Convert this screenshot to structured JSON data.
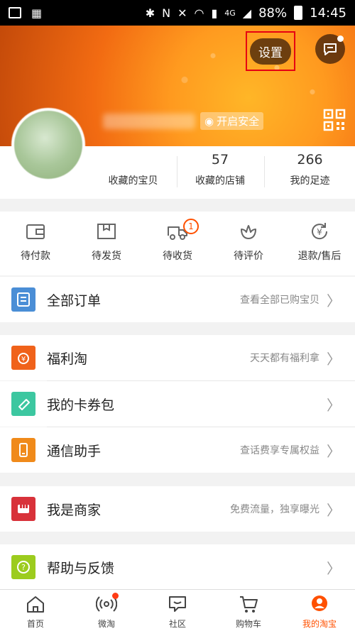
{
  "status_bar": {
    "battery": "88%",
    "time": "14:45",
    "network": "4G"
  },
  "header": {
    "settings_label": "设置",
    "safe_label": "开启安全"
  },
  "stats": [
    {
      "value": "",
      "label": "收藏的宝贝"
    },
    {
      "value": "57",
      "label": "收藏的店铺"
    },
    {
      "value": "266",
      "label": "我的足迹"
    }
  ],
  "orders": [
    {
      "label": "待付款"
    },
    {
      "label": "待发货"
    },
    {
      "label": "待收货",
      "badge": "1"
    },
    {
      "label": "待评价"
    },
    {
      "label": "退款/售后"
    }
  ],
  "rows": {
    "all_orders": {
      "title": "全部订单",
      "hint": "查看全部已购宝贝",
      "color": "#4a8ed6"
    },
    "fuli": {
      "title": "福利淘",
      "hint": "天天都有福利拿",
      "color": "#f0621a"
    },
    "coupons": {
      "title": "我的卡券包",
      "hint": "",
      "color": "#3cc7a0"
    },
    "telecom": {
      "title": "通信助手",
      "hint": "查话费享专属权益",
      "color": "#f08a1a"
    },
    "merchant": {
      "title": "我是商家",
      "hint": "免费流量，独享曝光",
      "color": "#d8323a"
    },
    "help": {
      "title": "帮助与反馈",
      "hint": "",
      "color": "#9ccc1e"
    }
  },
  "tabbar": [
    {
      "label": "首页"
    },
    {
      "label": "微淘"
    },
    {
      "label": "社区"
    },
    {
      "label": "购物车"
    },
    {
      "label": "我的淘宝"
    }
  ],
  "colors": {
    "accent": "#ff5000"
  }
}
